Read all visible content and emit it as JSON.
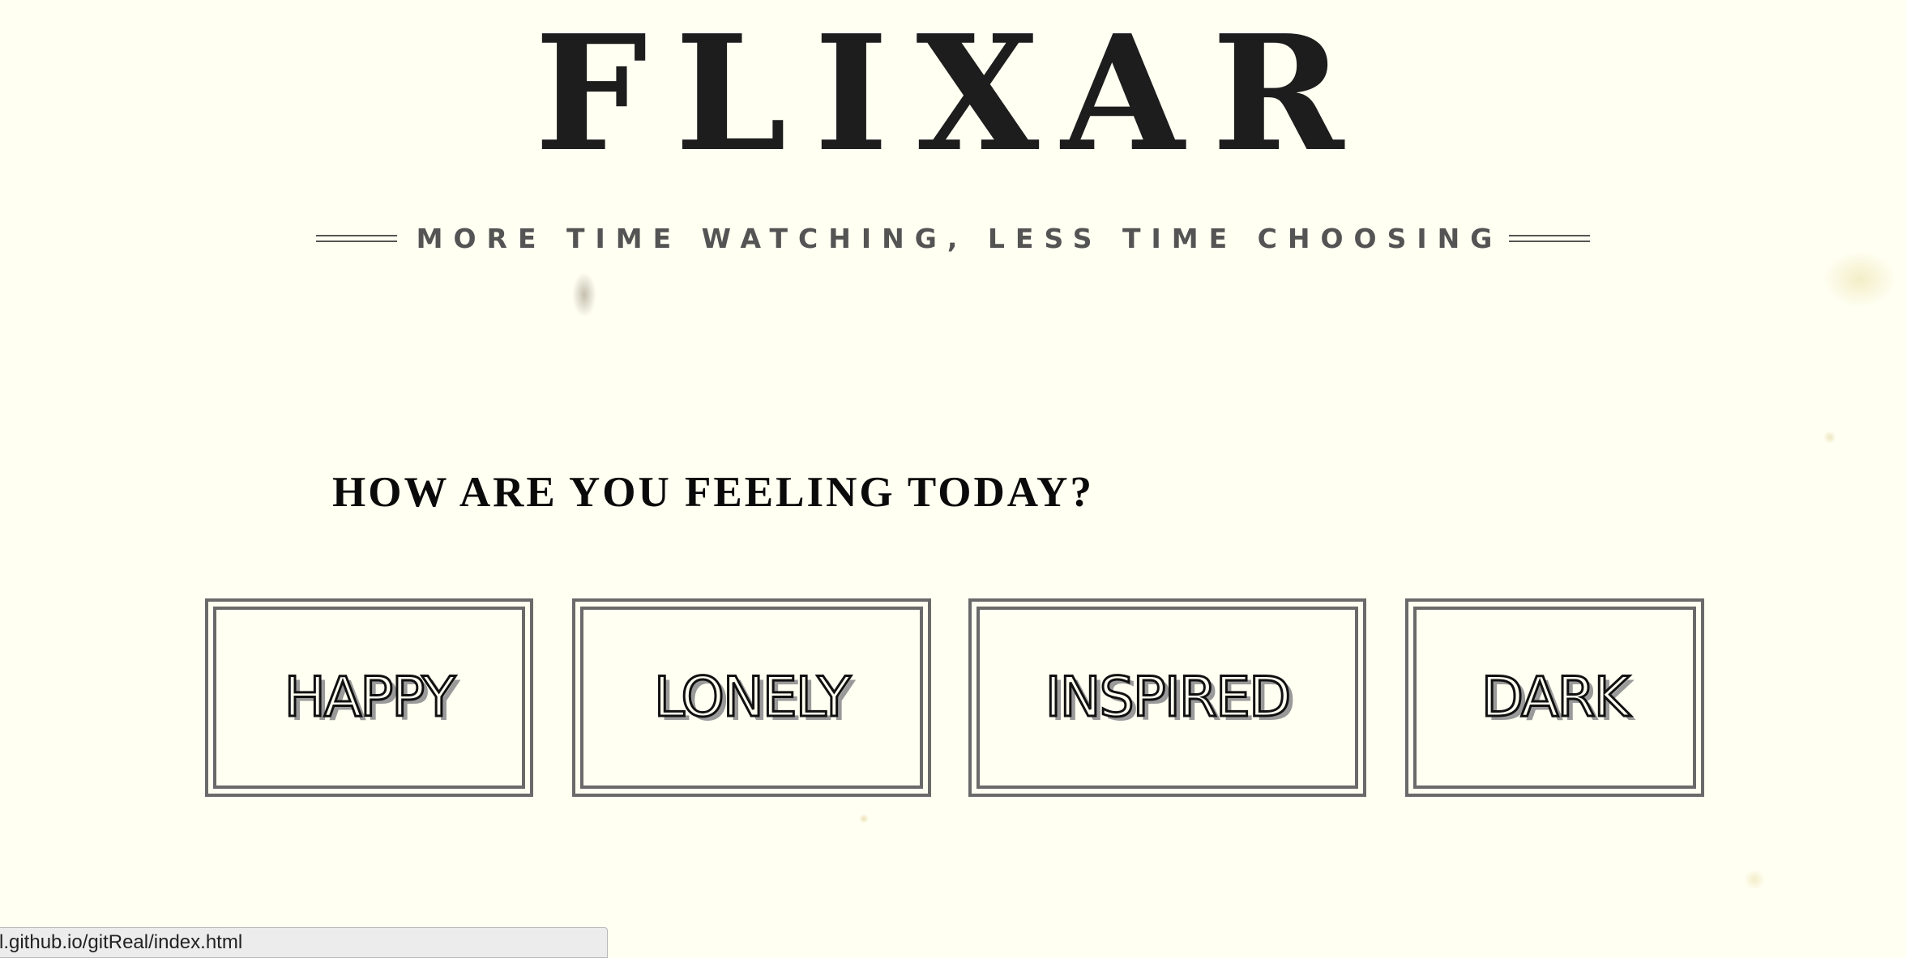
{
  "header": {
    "title": "FLIXAR",
    "tagline": "MORE TIME WATCHING, LESS TIME CHOOSING"
  },
  "main": {
    "question": "HOW ARE YOU FEELING TODAY?",
    "moods": [
      {
        "label": "HAPPY"
      },
      {
        "label": "LONELY"
      },
      {
        "label": "INSPIRED"
      },
      {
        "label": "DARK"
      }
    ]
  },
  "statusbar": {
    "url": "l.github.io/gitReal/index.html"
  },
  "colors": {
    "background": "#fffff2",
    "title": "#1d1d1d",
    "tagline": "#545454",
    "box_border": "#6a6a6a"
  }
}
